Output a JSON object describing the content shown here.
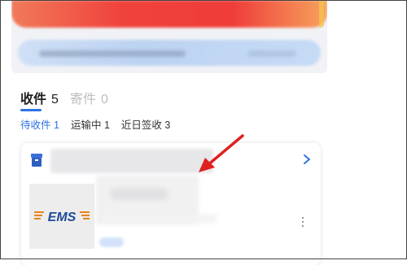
{
  "tabs": [
    {
      "label": "收件",
      "count": "5"
    },
    {
      "label": "寄件",
      "count": "0"
    }
  ],
  "filters": [
    {
      "label": "待收件",
      "count": "1"
    },
    {
      "label": "运输中",
      "count": "1"
    },
    {
      "label": "近日签收",
      "count": "3"
    }
  ],
  "package": {
    "carrier_logo": "EMS"
  },
  "icons": {
    "header": "package-box-icon",
    "chevron": "chevron-right-icon",
    "more": "more-vertical-icon",
    "annotation": "red-arrow"
  },
  "colors": {
    "accent": "#2e72e6",
    "arrow": "#e02020",
    "ems_blue": "#1f4a9a",
    "ems_orange": "#e8841e"
  }
}
